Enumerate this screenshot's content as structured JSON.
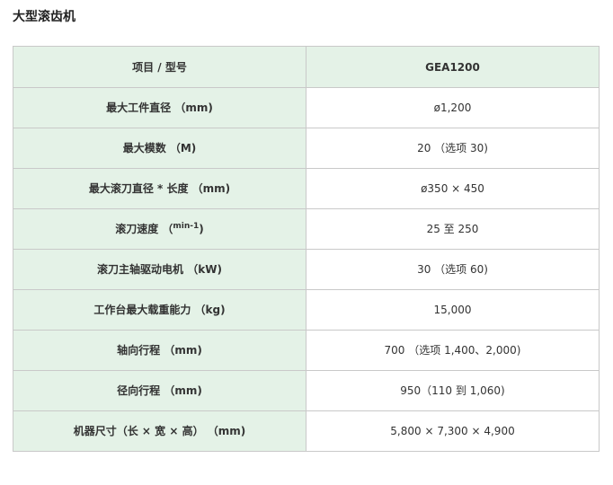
{
  "page_title": "大型滚齿机",
  "table": {
    "header": {
      "label": "项目 / 型号",
      "value": "GEA1200"
    },
    "rows": [
      {
        "label": "最大工件直径 （mm)",
        "value": "ø1,200"
      },
      {
        "label": "最大模数 （M)",
        "value": "20 （选项 30)"
      },
      {
        "label": "最大滚刀直径 * 长度 （mm)",
        "value": "ø350 × 450"
      },
      {
        "label_pre": "滚刀速度 （",
        "label_sup": "min-1",
        "label_post": ")",
        "value": "25 至 250"
      },
      {
        "label": "滚刀主轴驱动电机 （kW)",
        "value": "30 （选项 60)"
      },
      {
        "label": "工作台最大载重能力 （kg)",
        "value": "15,000"
      },
      {
        "label": "轴向行程 （mm)",
        "value": "700 （选项 1,400、2,000)"
      },
      {
        "label": "径向行程 （mm)",
        "value": "950（110 到 1,060)"
      },
      {
        "label": "机器尺寸（长 × 宽 × 高） （mm)",
        "value": "5,800 × 7,300 × 4,900"
      }
    ]
  }
}
